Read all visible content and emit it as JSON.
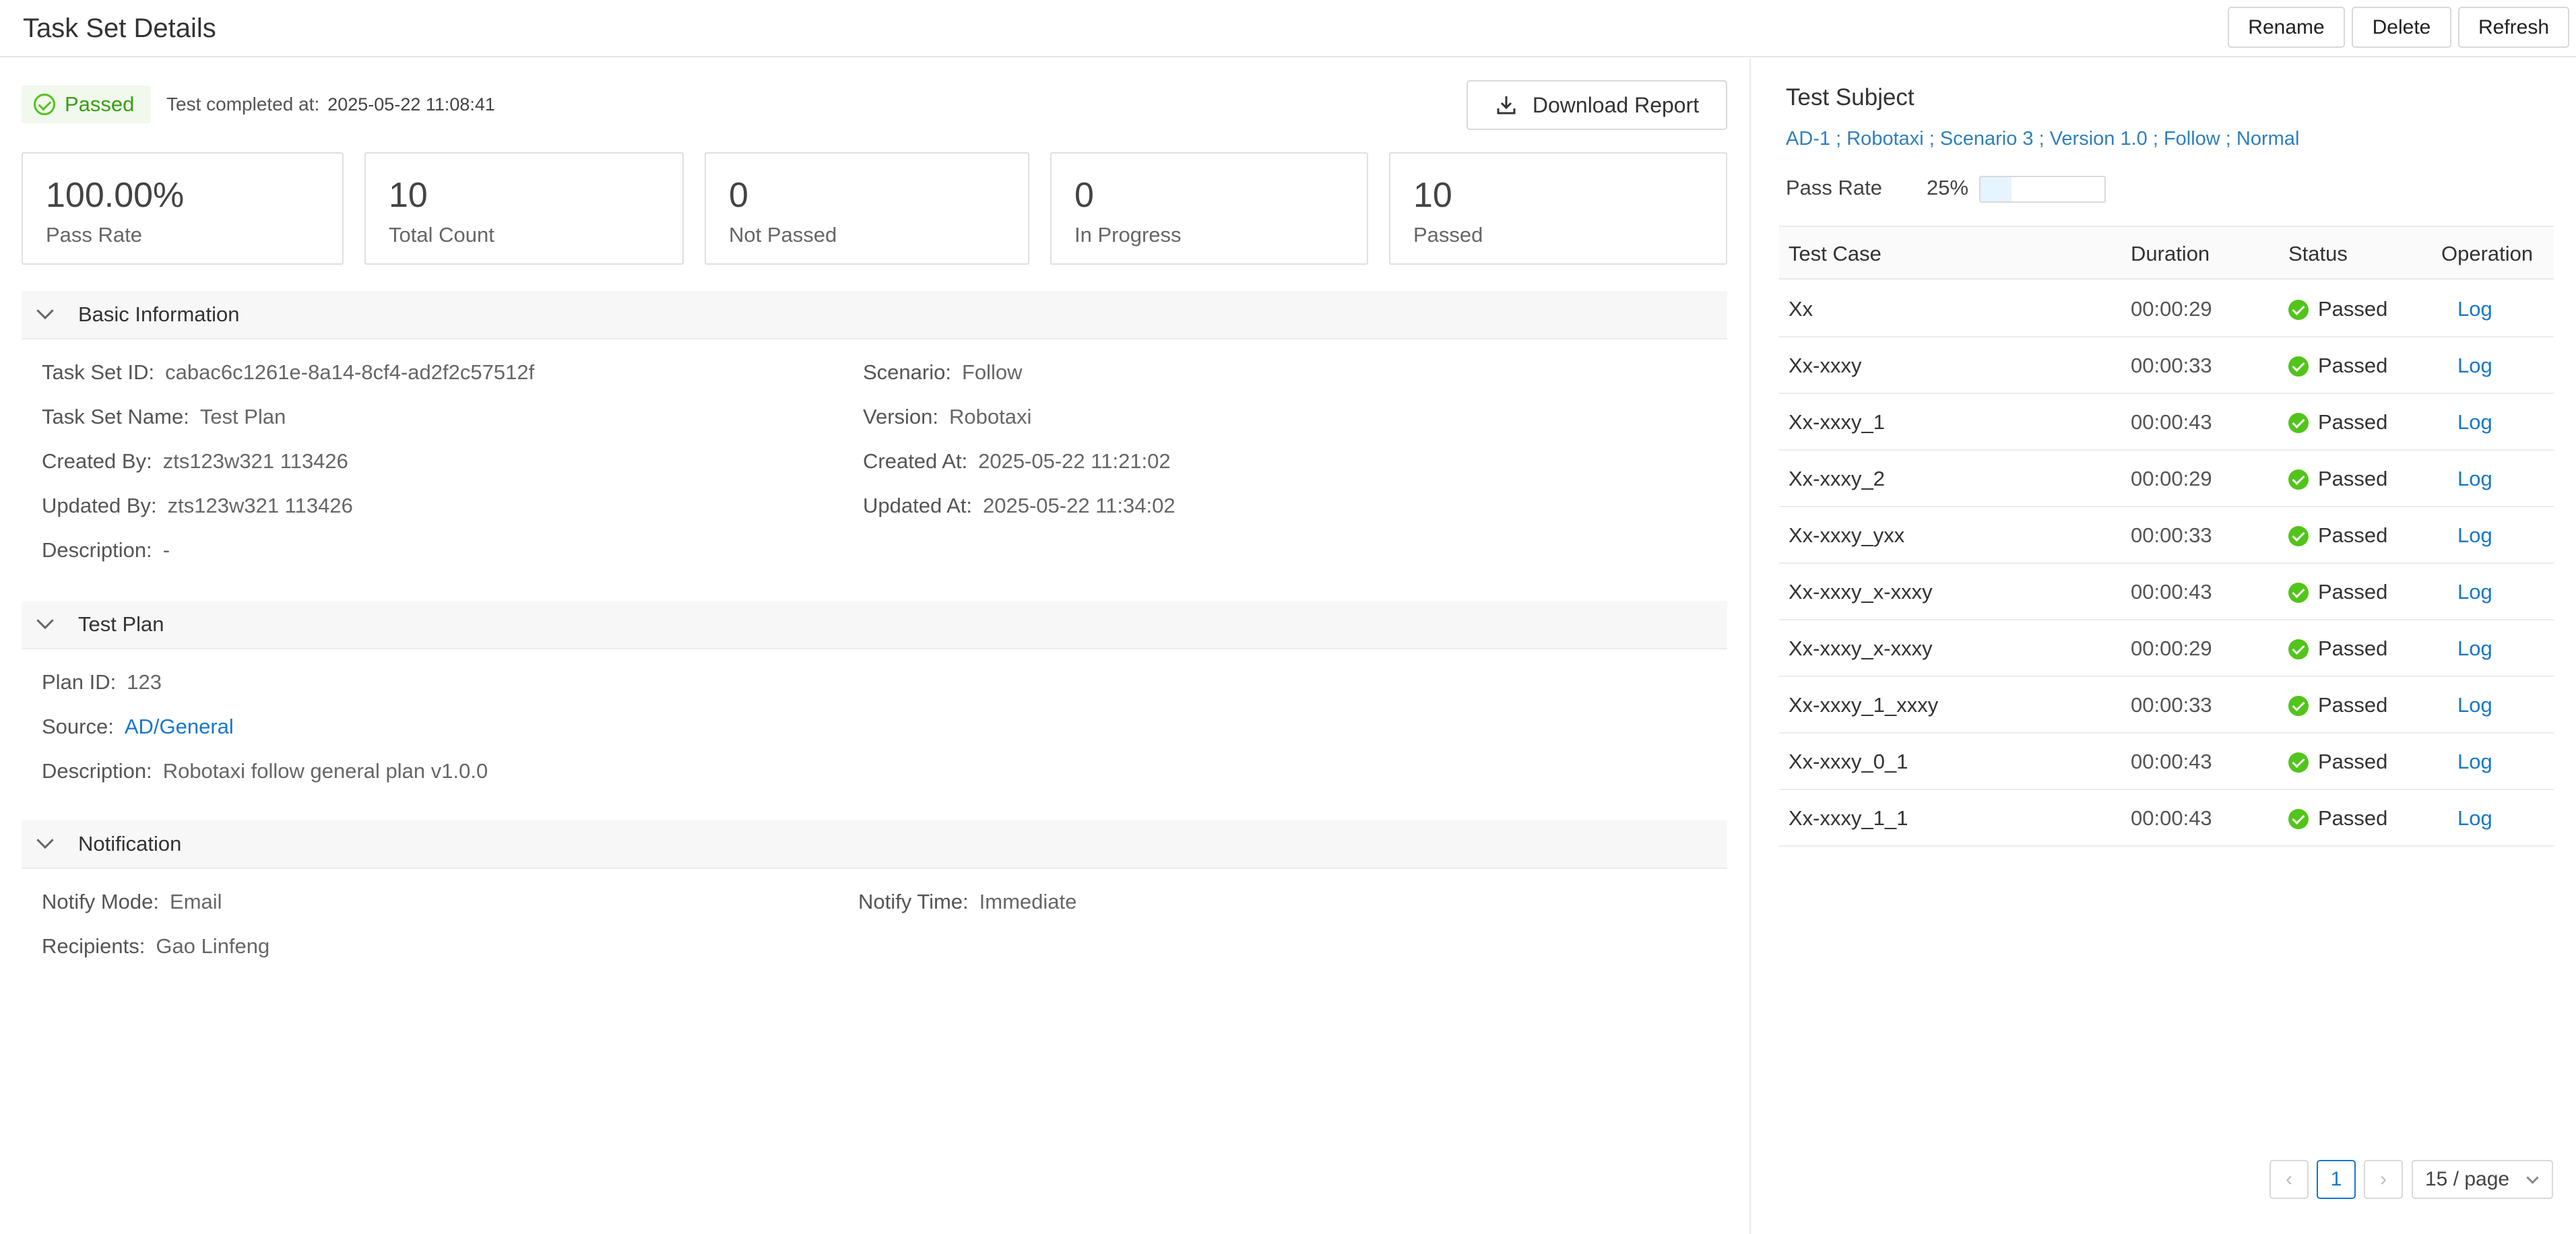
{
  "header": {
    "title": "Task Set Details",
    "rename_label": "Rename",
    "delete_label": "Delete",
    "refresh_label": "Refresh"
  },
  "status": {
    "label": "Passed",
    "completed_label": "Test completed at:",
    "completed_value": "2025-05-22 11:08:41",
    "download_label": "Download Report"
  },
  "stats": [
    {
      "value": "100.00%",
      "label": "Pass Rate"
    },
    {
      "value": "10",
      "label": "Total Count"
    },
    {
      "value": "0",
      "label": "Not Passed"
    },
    {
      "value": "0",
      "label": "In Progress"
    },
    {
      "value": "10",
      "label": "Passed"
    }
  ],
  "basic_info": {
    "title": "Basic Information",
    "task_set_id": {
      "label": "Task Set ID:",
      "value": "cabac6c1261e-8a14-8cf4-ad2f2c57512f"
    },
    "task_set_name": {
      "label": "Task Set Name:",
      "value": "Test Plan"
    },
    "created_by": {
      "label": "Created By:",
      "value": "zts123w321 113426"
    },
    "updated_by": {
      "label": "Updated By:",
      "value": "zts123w321 113426"
    },
    "description": {
      "label": "Description:",
      "value": "-"
    },
    "scenario": {
      "label": "Scenario:",
      "value": "Follow"
    },
    "version": {
      "label": "Version:",
      "value": "Robotaxi"
    },
    "created_at": {
      "label": "Created At:",
      "value": "2025-05-22 11:21:02"
    },
    "updated_at": {
      "label": "Updated At:",
      "value": "2025-05-22 11:34:02"
    }
  },
  "test_plan": {
    "title": "Test Plan",
    "plan_id": {
      "label": "Plan ID:",
      "value": "123"
    },
    "source": {
      "label": "Source:",
      "value": "AD/General"
    },
    "description": {
      "label": "Description:",
      "value": "Robotaxi follow general plan v1.0.0"
    }
  },
  "notification": {
    "title": "Notification",
    "notify_mode": {
      "label": "Notify Mode:",
      "value": "Email"
    },
    "notify_time": {
      "label": "Notify Time:",
      "value": "Immediate"
    },
    "recipients": {
      "label": "Recipients:",
      "value": "Gao Linfeng"
    }
  },
  "subject": {
    "title": "Test Subject",
    "path": "AD-1 ; Robotaxi ; Scenario 3 ; Version 1.0 ; Follow ; Normal",
    "pass_rate_label": "Pass Rate",
    "pass_rate_value": "25%",
    "pass_rate_fraction": 0.25
  },
  "table": {
    "headers": [
      "Test Case",
      "Duration",
      "Status",
      "Operation"
    ],
    "rows": [
      {
        "name": "Xx",
        "duration": "00:00:29",
        "status": "Passed",
        "op": "Log"
      },
      {
        "name": "Xx-xxxy",
        "duration": "00:00:33",
        "status": "Passed",
        "op": "Log"
      },
      {
        "name": "Xx-xxxy_1",
        "duration": "00:00:43",
        "status": "Passed",
        "op": "Log"
      },
      {
        "name": "Xx-xxxy_2",
        "duration": "00:00:29",
        "status": "Passed",
        "op": "Log"
      },
      {
        "name": "Xx-xxxy_yxx",
        "duration": "00:00:33",
        "status": "Passed",
        "op": "Log"
      },
      {
        "name": "Xx-xxxy_x-xxxy",
        "duration": "00:00:43",
        "status": "Passed",
        "op": "Log"
      },
      {
        "name": "Xx-xxxy_x-xxxy",
        "duration": "00:00:29",
        "status": "Passed",
        "op": "Log"
      },
      {
        "name": "Xx-xxxy_1_xxxy",
        "duration": "00:00:33",
        "status": "Passed",
        "op": "Log"
      },
      {
        "name": "Xx-xxxy_0_1",
        "duration": "00:00:43",
        "status": "Passed",
        "op": "Log"
      },
      {
        "name": "Xx-xxxy_1_1",
        "duration": "00:00:43",
        "status": "Passed",
        "op": "Log"
      }
    ]
  },
  "pagination": {
    "current_page": "1",
    "page_size": "15 / page"
  }
}
